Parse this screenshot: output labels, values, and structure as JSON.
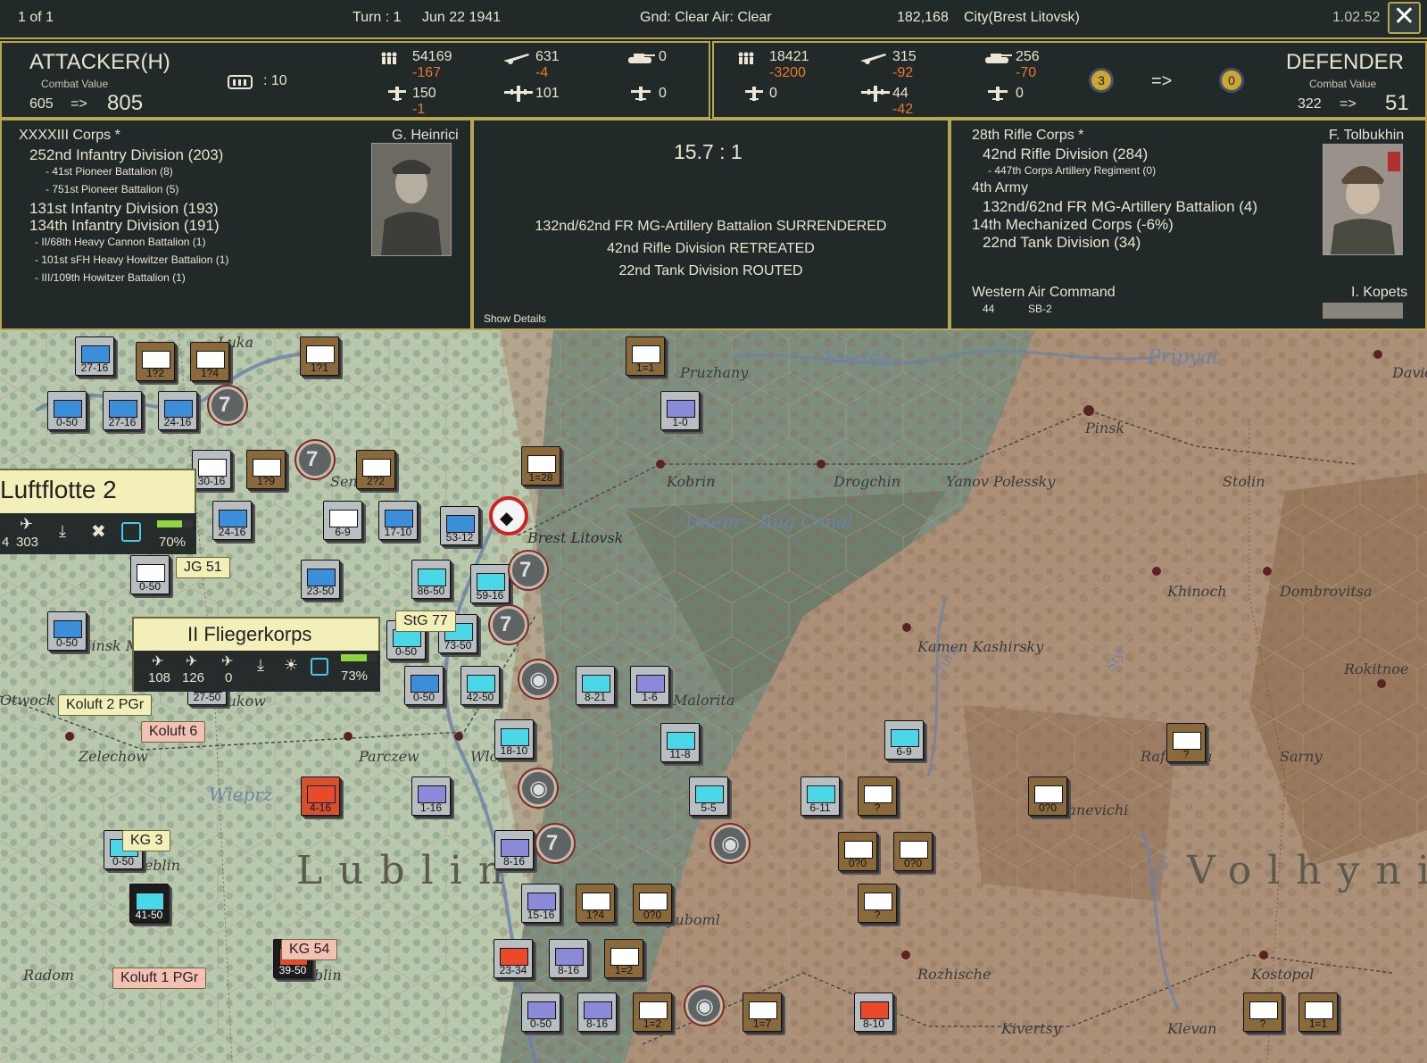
{
  "topbar": {
    "page_counter": "1 of 1",
    "turn": "Turn : 1",
    "date": "Jun 22 1941",
    "weather": "Gnd: Clear  Air: Clear",
    "hex_id": "182,168",
    "location": "City(Brest Litovsk)",
    "version": "1.02.52",
    "close_glyph": "✕"
  },
  "attacker": {
    "title": "ATTACKER(H)",
    "cv_label": "Combat Value",
    "cv_from": "605",
    "arrow": "=>",
    "cv_to": "805",
    "rail_value": ": 10",
    "men": "54169",
    "men_loss": "-167",
    "guns": "631",
    "guns_loss": "-4",
    "tanks": "0",
    "fighters": "150",
    "fighters_loss": "-1",
    "bombers": "101",
    "other_air": "0"
  },
  "defender": {
    "title": "DEFENDER",
    "cv_label": "Combat Value",
    "cv_from": "322",
    "arrow": "=>",
    "cv_to": "51",
    "men": "18421",
    "men_loss": "-3200",
    "guns": "315",
    "guns_loss": "-92",
    "tanks": "256",
    "tanks_loss": "-70",
    "fighters": "0",
    "bombers": "44",
    "bombers_loss": "-42",
    "other_air": "0",
    "fort_from": "3",
    "fort_arrow": "=>",
    "fort_to": "0"
  },
  "attacker_units": {
    "commander": "G. Heinrici",
    "lines": [
      "XXXXIII Corps *",
      "252nd Infantry Division (203)",
      "- 41st Pioneer Battalion (8)",
      "- 751st Pioneer Battalion (5)",
      "131st Infantry Division (193)",
      "134th Infantry Division (191)",
      "- II/68th Heavy Cannon Battalion (1)",
      "- 101st sFH Heavy Howitzer Battalion (1)",
      "- III/109th Howitzer Battalion (1)"
    ]
  },
  "result": {
    "odds": "15.7 : 1",
    "lines": [
      "132nd/62nd FR MG-Artillery Battalion SURRENDERED",
      "42nd Rifle Division RETREATED",
      "22nd Tank Division ROUTED"
    ],
    "show_details": "Show Details"
  },
  "defender_units": {
    "commander": "F. Tolbukhin",
    "lines": [
      "28th Rifle Corps *",
      "42nd Rifle Division (284)",
      "- 447th Corps Artillery Regiment (0)",
      "4th Army",
      "132nd/62nd FR MG-Artillery Battalion (4)",
      "14th Mechanized Corps (-6%)",
      "22nd Tank Division (34)"
    ],
    "air_command": "Western Air Command",
    "air_count": "44",
    "air_type": "SB-2",
    "air_commander": "I. Kopets"
  },
  "air_groups": {
    "luftflotte": {
      "name": "Luftflotte 2",
      "fighters": "4",
      "other": "303",
      "readiness": "70%",
      "readiness_value": 0.7
    },
    "fliegerkorps": {
      "name": "II Fliegerkorps",
      "fighters": "108",
      "bombers": "126",
      "recon": "0",
      "readiness": "73%",
      "readiness_value": 0.73
    }
  },
  "map": {
    "tags": [
      "JG 51",
      "StG 77",
      "Koluft 2 PGr",
      "Koluft 6",
      "KG 3",
      "KG 54",
      "Koluft 1 PGr"
    ],
    "places": [
      "Kobrin",
      "Drogchin",
      "Yanov Polessky",
      "Pinsk",
      "Stolin",
      "Brest Litovsk",
      "Khinoch",
      "Dombrovitsa",
      "Kamen Kashirsky",
      "Rokitnoe",
      "Malorita",
      "Rafalovka",
      "Sarny",
      "Zelechow",
      "Parczew",
      "Wlodawa",
      "Lyuboml",
      "Manevichi",
      "Radom",
      "Lublin",
      "Rozhische",
      "Kostopol",
      "Kivertsy",
      "Klevan",
      "Deblin",
      "Otwock",
      "Minsk M.",
      "Lukow",
      "Seny",
      "Pruzhany",
      "Luka",
      "David"
    ],
    "rivers": [
      "Yaselda",
      "Pripyat",
      "Dnepr - Bug Canal",
      "Wieprz",
      "Turia",
      "Styr",
      "Goryn"
    ],
    "regions": [
      "Lublin",
      "Volhynia"
    ],
    "counters": [
      "27-16",
      "1?2",
      "1?4",
      "1?1",
      "1=1",
      "0-50",
      "27-16",
      "24-16",
      "1-0",
      "1?9",
      "2?2",
      "1=28",
      "30-16",
      "6-9",
      "17-10",
      "53-12",
      "24-16",
      "0-50",
      "23-50",
      "86-50",
      "59-16",
      "0-50",
      "73-50",
      "0-50",
      "27-50",
      "0-50",
      "42-50",
      "8-21",
      "1-6",
      "18-10",
      "11-8",
      "6-9",
      "4-16",
      "1-16",
      "5-5",
      "6-11",
      "?",
      "0?0",
      "?",
      "0?0",
      "0?0",
      "8-16",
      "15-16",
      "1?4",
      "0?0",
      "?",
      "41-50",
      "0-50",
      "39-50",
      "23-34",
      "8-16",
      "1=2",
      "0-50",
      "8-16",
      "1=2",
      "1=7",
      "8-10",
      "?",
      "1=1"
    ]
  }
}
